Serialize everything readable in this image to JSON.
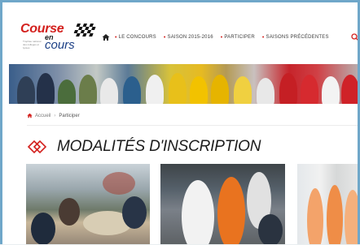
{
  "logo": {
    "word1": "Course",
    "word2": "en",
    "word3": "cours",
    "tagline": "Trophée national des collèges et lycées"
  },
  "nav": {
    "items": [
      {
        "label": "LE CONCOURS"
      },
      {
        "label": "SAISON 2015-2016"
      },
      {
        "label": "PARTICIPER"
      },
      {
        "label": "SAISONS PRÉCÉDENTES"
      }
    ]
  },
  "breadcrumb": {
    "home": "Accueil",
    "current": "Participer"
  },
  "page": {
    "title": "MODALITÉS D'INSCRIPTION"
  },
  "colors": {
    "accent_red": "#d3201d",
    "logo_blue": "#1b3f85",
    "frame_blue": "#6fa7c9"
  },
  "icons": {
    "home": "home-icon",
    "search": "search-icon",
    "flag": "checkered-flag-icon",
    "title_deco": "diamond-icon"
  }
}
